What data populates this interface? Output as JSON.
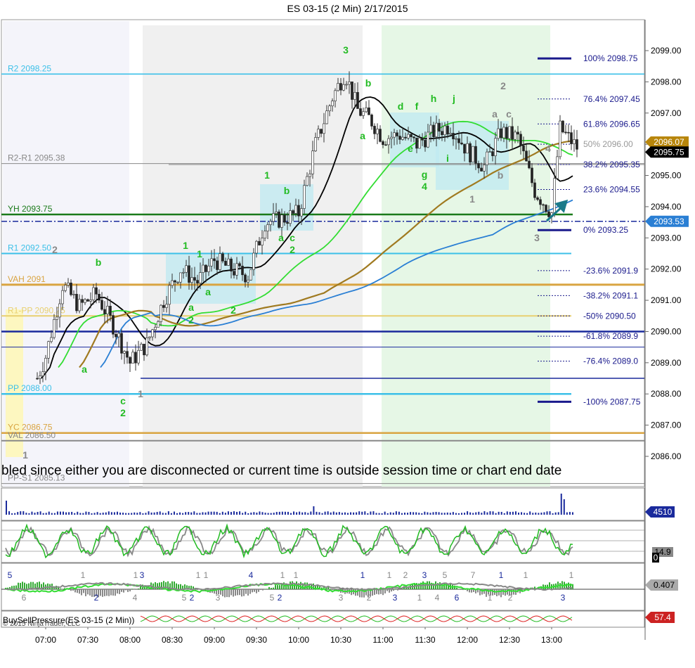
{
  "title": "ES 03-15 (2 Min)  2/17/2015",
  "banner": "bled since either you are disconnected or current time is outside session time or chart end date",
  "colors": {
    "up": "#00cc00",
    "down": "#002aa0",
    "pivot": "#3cc0e8",
    "vah": "#d9a441",
    "fib": "#1a1a8c",
    "bg_session": "#f0f0f0",
    "bg_green": "#e6f7e6"
  },
  "chart_data": {
    "type": "candlestick",
    "title": "ES 03-15 (2 Min)  2/17/2015",
    "ylim": [
      2085.75,
      2099.5
    ],
    "y_ticks": [
      "2099.00",
      "2098.00",
      "2097.00",
      "2096.00",
      "2095.00",
      "2094.00",
      "2093.00",
      "2092.00",
      "2091.00",
      "2090.00",
      "2089.00",
      "2088.00",
      "2087.00",
      "2086.00"
    ],
    "x_ticks": [
      "07:00",
      "07:30",
      "08:00",
      "08:30",
      "09:00",
      "09:30",
      "10:00",
      "10:30",
      "11:00",
      "11:30",
      "12:00",
      "12:30",
      "13:00"
    ],
    "price_badges": [
      {
        "value": "2096.07",
        "color": "#b8860b"
      },
      {
        "value": "2095.75",
        "color": "#000000"
      },
      {
        "value": "2093.53",
        "color": "#2a7fd4"
      }
    ],
    "levels": [
      {
        "name": "R2",
        "label": "R2 2098.25",
        "value": 2098.25,
        "color": "#3cc0e8"
      },
      {
        "name": "R2-R1",
        "label": "R2-R1 2095.38",
        "value": 2095.38,
        "color": "#888888"
      },
      {
        "name": "YH",
        "label": "YH 2093.75",
        "value": 2093.75,
        "color": "#1a7a1a"
      },
      {
        "name": "R1",
        "label": "R1 2092.50",
        "value": 2092.5,
        "color": "#3cc0e8"
      },
      {
        "name": "VAH",
        "label": "VAH 2091",
        "value": 2091.5,
        "color": "#d9a441"
      },
      {
        "name": "R1-PP",
        "label": "R1-PP 2090.25",
        "value": 2090.5,
        "color": "#e8d070"
      },
      {
        "name": "PP",
        "label": "PP 2088.00",
        "value": 2088.0,
        "color": "#3cc0e8"
      },
      {
        "name": "YC",
        "label": "YC 2086.75",
        "value": 2086.75,
        "color": "#d9a441"
      },
      {
        "name": "VAL",
        "label": "VAL 2086.50",
        "value": 2086.5,
        "color": "#888888"
      },
      {
        "name": "PP-S1",
        "label": "PP-S1 2085.13",
        "value": 2085.13,
        "color": "#888888"
      }
    ],
    "fib_levels": [
      {
        "label": "100%  2098.75",
        "value": 2098.75
      },
      {
        "label": "76.4%  2097.45",
        "value": 2097.45
      },
      {
        "label": "61.8%  2096.65",
        "value": 2096.65
      },
      {
        "label": "50%  2096.00",
        "value": 2096.0
      },
      {
        "label": "38.2%  2095.35",
        "value": 2095.35
      },
      {
        "label": "23.6%  2094.55",
        "value": 2094.55
      },
      {
        "label": "0%  2093.25",
        "value": 2093.25
      },
      {
        "label": "-23.6%  2091.9",
        "value": 2091.95
      },
      {
        "label": "-38.2%  2091.1",
        "value": 2091.15
      },
      {
        "label": "-50%  2090.50",
        "value": 2090.5
      },
      {
        "label": "-61.8%  2089.9",
        "value": 2089.85
      },
      {
        "label": "-76.4%  2089.0",
        "value": 2089.05
      },
      {
        "label": "-100%  2087.75",
        "value": 2087.75
      }
    ],
    "close_path": [
      [
        6.9,
        2088.5
      ],
      [
        7.0,
        2089.2
      ],
      [
        7.2,
        2091.5
      ],
      [
        7.4,
        2090.8
      ],
      [
        7.6,
        2091.2
      ],
      [
        7.8,
        2090.2
      ],
      [
        8.0,
        2089.0
      ],
      [
        8.2,
        2089.6
      ],
      [
        8.4,
        2091.0
      ],
      [
        8.6,
        2092.0
      ],
      [
        8.8,
        2091.6
      ],
      [
        9.0,
        2092.3
      ],
      [
        9.2,
        2092.0
      ],
      [
        9.4,
        2091.8
      ],
      [
        9.6,
        2093.5
      ],
      [
        9.8,
        2093.6
      ],
      [
        10.0,
        2093.8
      ],
      [
        10.2,
        2096.0
      ],
      [
        10.4,
        2097.5
      ],
      [
        10.55,
        2098.3
      ],
      [
        10.7,
        2097.1
      ],
      [
        10.85,
        2096.8
      ],
      [
        11.0,
        2096.2
      ],
      [
        11.2,
        2096.3
      ],
      [
        11.4,
        2096.0
      ],
      [
        11.6,
        2096.4
      ],
      [
        11.8,
        2096.6
      ],
      [
        12.0,
        2095.8
      ],
      [
        12.2,
        2095.3
      ],
      [
        12.4,
        2096.4
      ],
      [
        12.6,
        2096.2
      ],
      [
        12.8,
        2094.5
      ],
      [
        13.0,
        2093.8
      ],
      [
        13.1,
        2096.5
      ],
      [
        13.3,
        2095.9
      ]
    ],
    "annotations": [
      "1",
      "2",
      "b",
      "a",
      "c",
      "2",
      "1",
      "1",
      "a",
      "2",
      "1",
      "a",
      "2",
      "1",
      "b",
      "a",
      "c",
      "2",
      "3",
      "b",
      "a",
      "d",
      "f",
      "e",
      "g",
      "4",
      "h",
      "j",
      "i",
      "a",
      "c",
      "b",
      "1",
      "2",
      "3",
      "4"
    ],
    "volume": {
      "label": "4510",
      "bars_max": 4510
    },
    "stoch": {
      "label": "14.9",
      "label2": "0"
    },
    "momentum": {
      "label": "0.407",
      "wave_labels": [
        "5",
        "6",
        "1",
        "2",
        "1",
        "4",
        "3",
        "5",
        "1",
        "2",
        "1",
        "3",
        "4",
        "5",
        "1",
        "2",
        "1",
        "3",
        "1",
        "2",
        "1",
        "3",
        "2",
        "1",
        "3",
        "4",
        "5",
        "6",
        "7",
        "1",
        "1",
        "2",
        "1",
        "3",
        "1",
        "2"
      ]
    },
    "bsp": {
      "label": "BuySellPressure(ES 03-15 (2 Min))",
      "value": "57.4",
      "copyright": "© 2015 NinjaTrader, LLC"
    }
  }
}
